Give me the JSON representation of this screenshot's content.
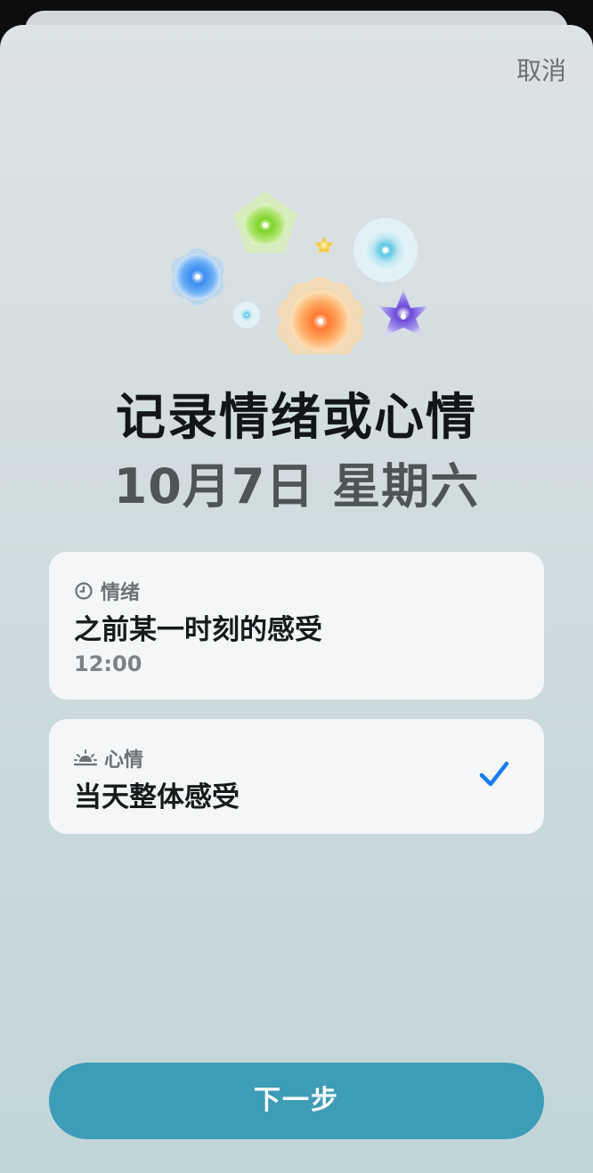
{
  "header": {
    "cancel_label": "取消"
  },
  "title": "记录情绪或心情",
  "date": "10月7日 星期六",
  "options": {
    "emotion": {
      "kicker_label": "情绪",
      "kicker_icon": "clock-icon",
      "main_label": "之前某一时刻的感受",
      "time": "12:00"
    },
    "mood": {
      "kicker_label": "心情",
      "kicker_icon": "sunrise-icon",
      "main_label": "当天整体感受",
      "selected": true
    }
  },
  "footer": {
    "next_label": "下一步"
  },
  "colors": {
    "accent": "#3d9cb6",
    "check": "#1a7cf0"
  }
}
